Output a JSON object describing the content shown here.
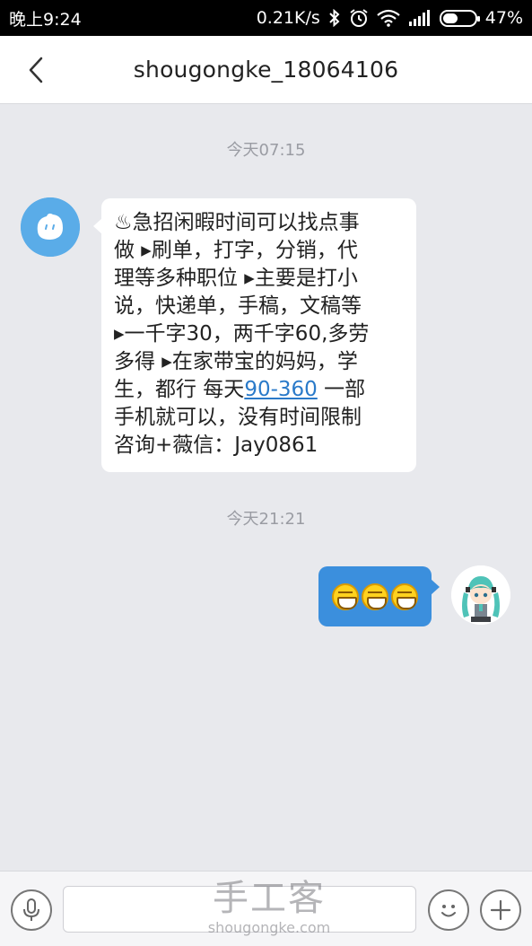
{
  "status_bar": {
    "time": "晚上9:24",
    "network_speed": "0.21K/s",
    "battery_percent": "47%",
    "battery_level": 0.47,
    "icons": [
      "bluetooth-icon",
      "alarm-icon",
      "wifi-icon",
      "signal-icon",
      "battery-icon"
    ]
  },
  "header": {
    "title": "shougongke_18064106",
    "back_icon": "chevron-left-icon"
  },
  "messages": [
    {
      "timestamp": "今天07:15",
      "direction": "incoming",
      "avatar_icon": "app-mascot-icon",
      "lines": [
        "♨急招闲暇时间可以找点事",
        "做 ▸刷单，打字，分销，代",
        "理等多种职位 ▸主要是打小",
        "说，快递单，手稿，文稿等",
        "▸一千字30，两千字60,多劳",
        "多得 ▸在家带宝的妈妈，学",
        "生，都行 每天",
        "90-360",
        " 一部",
        "手机就可以，没有时间限制",
        "咨询+薇信：Jay0861"
      ]
    },
    {
      "timestamp": "今天21:21",
      "direction": "outgoing",
      "avatar_icon": "anime-avatar-icon",
      "content_icons": [
        "grin-emoji-icon",
        "grin-emoji-icon",
        "grin-emoji-icon"
      ]
    }
  ],
  "input_bar": {
    "voice_icon": "microphone-icon",
    "text_value": "",
    "emoji_icon": "smiley-icon",
    "more_icon": "plus-icon"
  },
  "watermark": {
    "cn": "手工客",
    "en": "shougongke.com"
  },
  "colors": {
    "background": "#e8e9ed",
    "outgoing_bubble": "#3b8fdd",
    "link": "#2a7ac9",
    "mascot_avatar": "#5aace8"
  }
}
